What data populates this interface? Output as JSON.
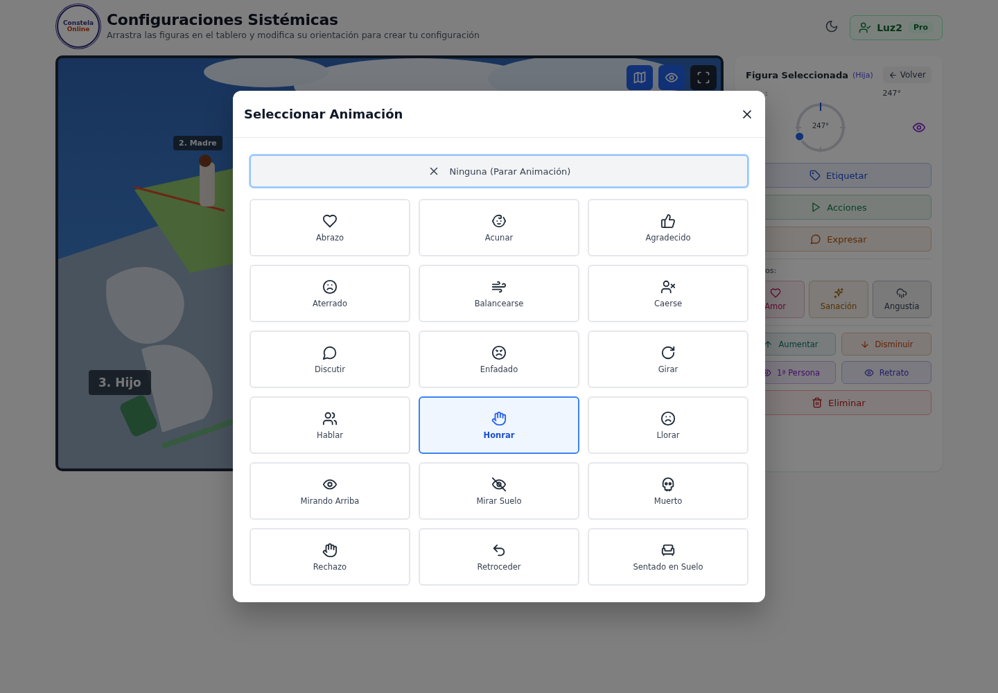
{
  "header": {
    "logo": {
      "line1": "Constela",
      "line2": "Online"
    },
    "title": "Configuraciones Sistémicas",
    "subtitle": "Arrastra las figuras en el tablero y modifica su orientación para crear tu configuración",
    "user": {
      "name": "Luz2",
      "badge": "Pro"
    }
  },
  "scene": {
    "labels": [
      {
        "text": "2. Madre"
      },
      {
        "text": "3. Hijo"
      }
    ],
    "tools": [
      {
        "on": true
      },
      {
        "on": true
      },
      {
        "on": false
      }
    ]
  },
  "panel": {
    "title": "Figura Seleccionada",
    "subtitle": "(Hija)",
    "back": "Volver",
    "rotation_label": ":",
    "rotation_value": "247°",
    "dial": {
      "reading": "247°"
    },
    "actions": [
      {
        "label": "Etiquetar"
      },
      {
        "label": "Acciones"
      },
      {
        "label": "Expresar"
      }
    ],
    "emotions_label": "os:",
    "emotions": [
      {
        "label": "Amor"
      },
      {
        "label": "Sanación"
      },
      {
        "label": "Angustia"
      }
    ],
    "controls": [
      {
        "label": "Aumentar"
      },
      {
        "label": "Disminuir"
      },
      {
        "label": "1ª Persona"
      },
      {
        "label": "Retrato"
      }
    ],
    "delete": "Eliminar"
  },
  "modal": {
    "title": "Seleccionar Animación",
    "none_option": "Ninguna (Parar Animación)",
    "animations": [
      {
        "label": "Abrazo",
        "selected": false
      },
      {
        "label": "Acunar",
        "selected": false
      },
      {
        "label": "Agradecido",
        "selected": false
      },
      {
        "label": "Aterrado",
        "selected": false
      },
      {
        "label": "Balancearse",
        "selected": false
      },
      {
        "label": "Caerse",
        "selected": false
      },
      {
        "label": "Discutir",
        "selected": false
      },
      {
        "label": "Enfadado",
        "selected": false
      },
      {
        "label": "Girar",
        "selected": false
      },
      {
        "label": "Hablar",
        "selected": false
      },
      {
        "label": "Honrar",
        "selected": true
      },
      {
        "label": "Llorar",
        "selected": false
      },
      {
        "label": "Mirando Arriba",
        "selected": false
      },
      {
        "label": "Mirar Suelo",
        "selected": false
      },
      {
        "label": "Muerto",
        "selected": false
      },
      {
        "label": "Rechazo",
        "selected": false
      },
      {
        "label": "Retroceder",
        "selected": false
      },
      {
        "label": "Sentado en Suelo",
        "selected": false
      }
    ]
  }
}
